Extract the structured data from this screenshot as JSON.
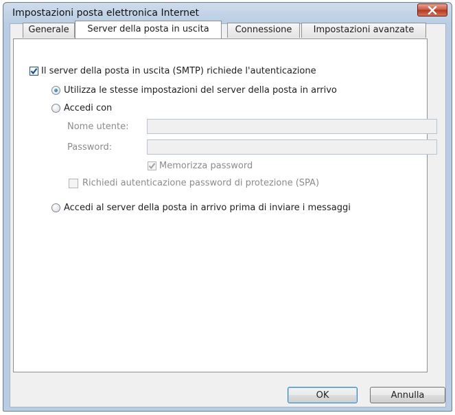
{
  "window": {
    "title": "Impostazioni posta elettronica Internet",
    "close_icon": "close-x-icon"
  },
  "tabs": [
    {
      "label": "Generale",
      "active": false
    },
    {
      "label": "Server della posta in uscita",
      "active": true
    },
    {
      "label": "Connessione",
      "active": false
    },
    {
      "label": "Impostazioni avanzate",
      "active": false
    }
  ],
  "smtp_auth": {
    "label": "Il server della posta in uscita (SMTP) richiede l'autenticazione",
    "checked": true
  },
  "options": {
    "same_settings": {
      "label": "Utilizza le stesse impostazioni del server della posta in arrivo",
      "selected": true
    },
    "login_with": {
      "label": "Accedi con",
      "selected": false
    },
    "login_before_send": {
      "label": "Accedi al server della posta in arrivo prima di inviare i messaggi",
      "selected": false
    }
  },
  "credentials": {
    "username_label": "Nome utente:",
    "username_value": "",
    "password_label": "Password:",
    "password_value": "",
    "remember_label": "Memorizza password",
    "remember_checked": true,
    "spa_label": "Richiedi autenticazione password di protezione (SPA)",
    "spa_checked": false
  },
  "buttons": {
    "ok": "OK",
    "cancel": "Annulla"
  },
  "colors": {
    "checkmark": "#1c4f86",
    "disabled": "#8b8b8b"
  }
}
